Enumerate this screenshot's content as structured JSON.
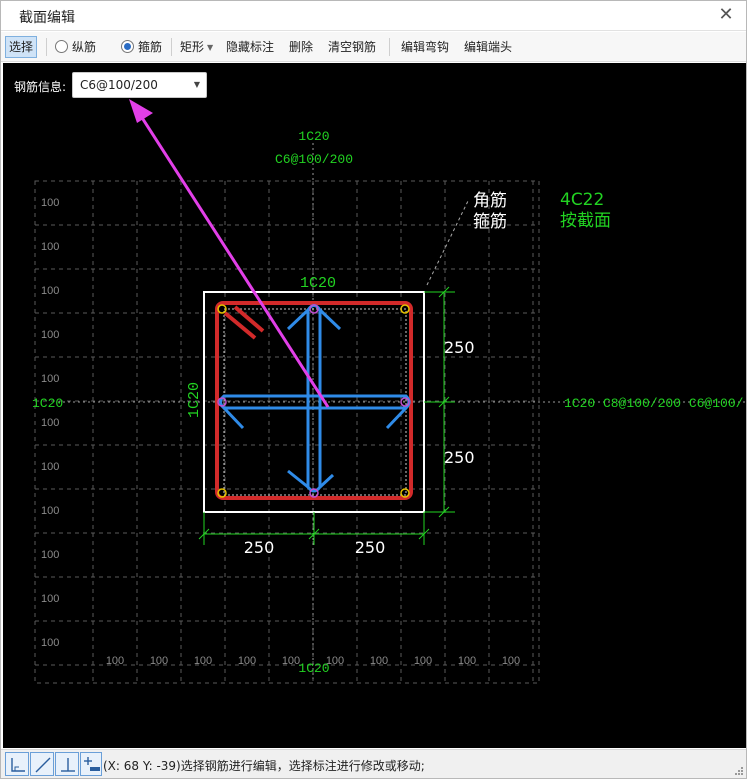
{
  "window": {
    "title": "截面编辑",
    "close_symbol": "✕"
  },
  "toolbar": {
    "select": "选择",
    "longitudinal": "纵筋",
    "stirrup": "箍筋",
    "rectangle": "矩形",
    "hide_dims": "隐藏标注",
    "delete": "删除",
    "clear_rebar": "清空钢筋",
    "edit_hook": "编辑弯钩",
    "edit_end": "编辑端头",
    "selected_radio": "stirrup"
  },
  "rebar_info": {
    "label": "钢筋信息:",
    "value": "C6@100/200"
  },
  "drawing": {
    "top_label_1": "1C20",
    "top_label_2": "C6@100/200",
    "corner_label": "角筋",
    "stirrup_label": "箍筋",
    "corner_spec": "4C22",
    "by_section": "按截面",
    "top_bar": "1C20",
    "left_bar_v": "1C20",
    "left_axis": "1C20",
    "right_axis": "1C20  C8@100/200  C6@100/",
    "bottom_axis": "1C20",
    "dim_right_top": "250",
    "dim_right_bottom": "250",
    "dim_bottom_left": "250",
    "dim_bottom_right": "250",
    "grid_y_labels": [
      "100",
      "100",
      "100",
      "100",
      "100",
      "100",
      "100",
      "100",
      "100",
      "100",
      "100"
    ],
    "grid_x_labels": [
      "100",
      "100",
      "100",
      "100",
      "100",
      "100",
      "100",
      "100",
      "100",
      "100"
    ]
  },
  "status": {
    "text": "(X: 68 Y: -39)选择钢筋进行编辑，选择标注进行修改或移动;"
  },
  "colors": {
    "canvas_bg": "#000000",
    "section_outline": "#ffffff",
    "outer_stirrup": "#d22a2a",
    "tie_bars": "#2f8be8",
    "annotation_green": "#22d322",
    "grid": "#5a5a5a",
    "leader_arrow": "#e23fe8",
    "corner_bar": "#e6c200"
  },
  "icons": {
    "close": "close-icon",
    "caret": "chevron-down-icon",
    "snap_endpoint": "snap-endpoint-icon",
    "snap_line": "snap-line-icon",
    "snap_perpendicular": "snap-perpendicular-icon",
    "snap_add": "snap-add-icon",
    "resize_grip": "resize-grip-icon"
  }
}
